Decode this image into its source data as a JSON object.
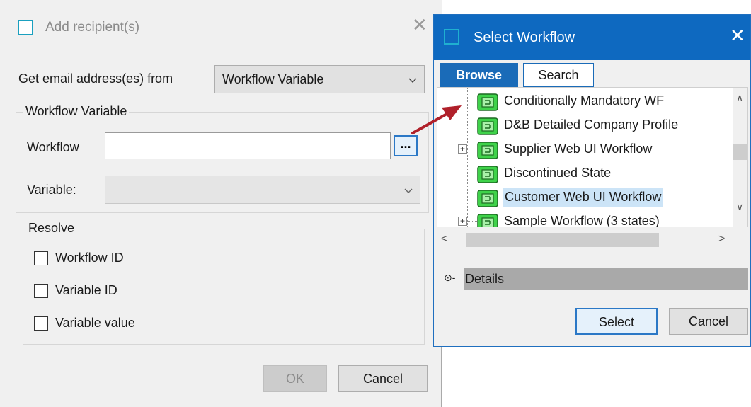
{
  "add_dialog": {
    "title": "Add recipient(s)",
    "close_glyph": "✕",
    "get_email_label": "Get email address(es) from",
    "source_select": {
      "value": "Workflow Variable",
      "icon": "chevron-down-icon"
    },
    "workflow_variable_group": {
      "legend": "Workflow Variable",
      "workflow_label": "Workflow",
      "workflow_value": "",
      "browse_button": "...",
      "variable_label": "Variable:",
      "variable_value": ""
    },
    "resolve_group": {
      "legend": "Resolve",
      "options": [
        {
          "label": "Workflow ID",
          "checked": false
        },
        {
          "label": "Variable ID",
          "checked": false
        },
        {
          "label": "Variable value",
          "checked": false
        }
      ]
    },
    "ok_label": "OK",
    "cancel_label": "Cancel"
  },
  "select_dialog": {
    "title": "Select Workflow",
    "close_glyph": "✕",
    "tabs": [
      {
        "label": "Browse",
        "active": true
      },
      {
        "label": "Search",
        "active": false
      }
    ],
    "tree_items": [
      {
        "label": "Conditionally Mandatory WF",
        "expandable": false,
        "selected": false
      },
      {
        "label": "D&B Detailed Company Profile",
        "expandable": false,
        "selected": false
      },
      {
        "label": "Supplier Web UI Workflow",
        "expandable": true,
        "selected": false
      },
      {
        "label": "Discontinued State",
        "expandable": false,
        "selected": false
      },
      {
        "label": "Customer Web UI Workflow",
        "expandable": false,
        "selected": true
      },
      {
        "label": "Sample Workflow (3 states)",
        "expandable": true,
        "selected": false
      }
    ],
    "details_label": "Details",
    "select_label": "Select",
    "cancel_label": "Cancel"
  },
  "colors": {
    "title_bar": "#0e69c0",
    "callout_arrow": "#b0202a",
    "selection": "#cce4f7"
  }
}
